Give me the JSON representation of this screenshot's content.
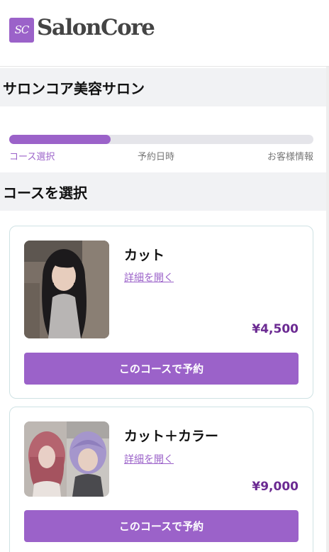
{
  "brand": {
    "logo_mark": "SC",
    "name": "SalonCore",
    "accent_color": "#9b62c9",
    "price_color": "#6b2a92"
  },
  "salon": {
    "name": "サロンコア美容サロン"
  },
  "progress": {
    "fraction": 0.333,
    "steps": [
      "コース選択",
      "予約日時",
      "お客様情報"
    ],
    "active_step": 0
  },
  "section": {
    "title": "コースを選択"
  },
  "courses": [
    {
      "name": "カット",
      "detail_label": "詳細を開く",
      "price": "¥4,500",
      "button_label": "このコースで予約",
      "image": "long-dark-hair-photo"
    },
    {
      "name": "カット＋カラー",
      "detail_label": "詳細を開く",
      "price": "¥9,000",
      "button_label": "このコースで予約",
      "image": "colored-hair-photo"
    }
  ]
}
